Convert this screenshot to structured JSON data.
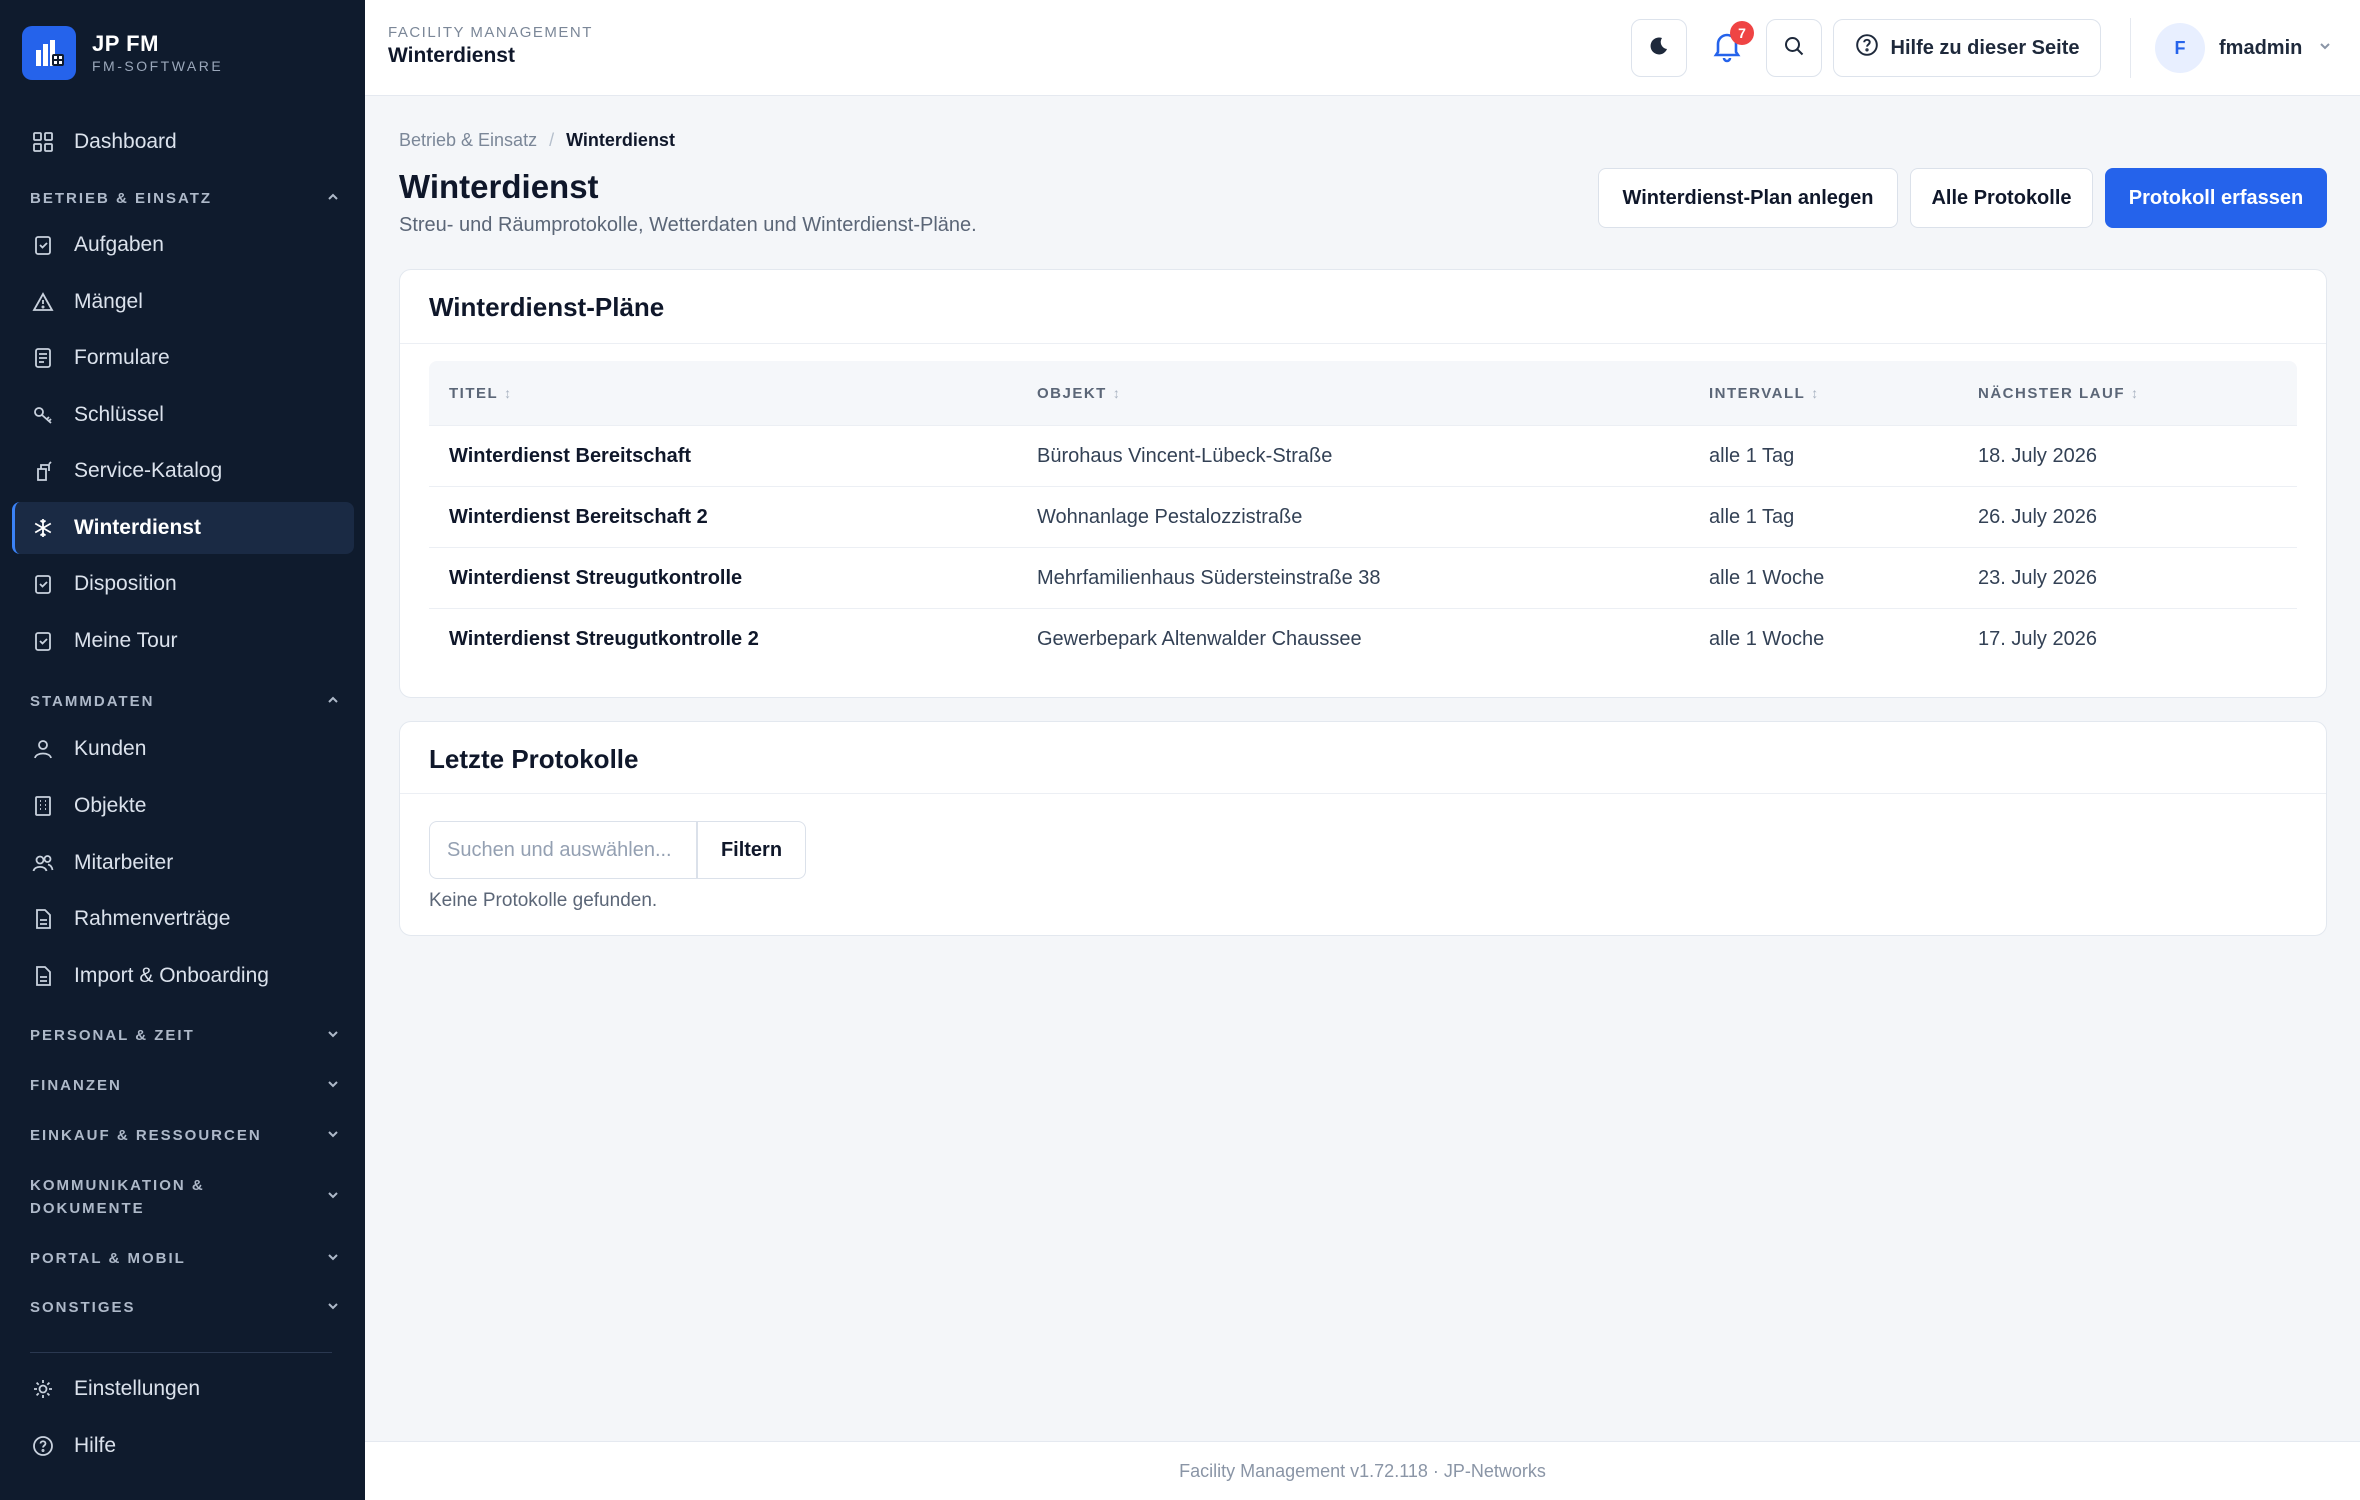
{
  "brand": {
    "title": "JP FM",
    "subtitle": "FM-SOFTWARE"
  },
  "sidebar": {
    "top_items": [
      {
        "label": "Dashboard",
        "icon": "grid-icon"
      }
    ],
    "sections": [
      {
        "label": "BETRIEB & EINSATZ",
        "expanded": true,
        "items": [
          {
            "label": "Aufgaben",
            "icon": "clipboard-check-icon"
          },
          {
            "label": "Mängel",
            "icon": "warning-triangle-icon"
          },
          {
            "label": "Formulare",
            "icon": "form-icon"
          },
          {
            "label": "Schlüssel",
            "icon": "key-icon"
          },
          {
            "label": "Service-Katalog",
            "icon": "service-icon"
          },
          {
            "label": "Winterdienst",
            "icon": "snowflake-icon",
            "active": true
          },
          {
            "label": "Disposition",
            "icon": "clipboard-check-icon"
          },
          {
            "label": "Meine Tour",
            "icon": "clipboard-check-icon"
          }
        ]
      },
      {
        "label": "STAMMDATEN",
        "expanded": true,
        "items": [
          {
            "label": "Kunden",
            "icon": "user-icon"
          },
          {
            "label": "Objekte",
            "icon": "building-icon"
          },
          {
            "label": "Mitarbeiter",
            "icon": "users-icon"
          },
          {
            "label": "Rahmenverträge",
            "icon": "document-icon"
          },
          {
            "label": "Import & Onboarding",
            "icon": "document-icon"
          }
        ]
      },
      {
        "label": "PERSONAL & ZEIT",
        "expanded": false
      },
      {
        "label": "FINANZEN",
        "expanded": false
      },
      {
        "label": "EINKAUF & RESSOURCEN",
        "expanded": false
      },
      {
        "label": "KOMMUNIKATION & DOKUMENTE",
        "expanded": false
      },
      {
        "label": "PORTAL & MOBIL",
        "expanded": false
      },
      {
        "label": "SONSTIGES",
        "expanded": false
      }
    ],
    "bottom_items": [
      {
        "label": "Einstellungen",
        "icon": "gear-icon"
      },
      {
        "label": "Hilfe",
        "icon": "help-circle-icon"
      }
    ]
  },
  "header": {
    "kicker": "FACILITY MANAGEMENT",
    "title": "Winterdienst",
    "notification_count": "7",
    "help_label": "Hilfe zu dieser Seite",
    "user_initial": "F",
    "user_name": "fmadmin"
  },
  "breadcrumb": {
    "parent": "Betrieb & Einsatz",
    "separator": "/",
    "current": "Winterdienst"
  },
  "page": {
    "title": "Winterdienst",
    "subtitle": "Streu- und Räumprotokolle, Wetterdaten und Winterdienst-Pläne.",
    "actions": {
      "create_plan": "Winterdienst-Plan anlegen",
      "all_protocols": "Alle Protokolle",
      "record_protocol": "Protokoll erfassen"
    }
  },
  "plans_card": {
    "title": "Winterdienst-Pläne",
    "columns": [
      "TITEL",
      "OBJEKT",
      "INTERVALL",
      "NÄCHSTER LAUF"
    ],
    "rows": [
      [
        "Winterdienst Bereitschaft",
        "Bürohaus Vincent-Lübeck-Straße",
        "alle 1 Tag",
        "18. July 2026"
      ],
      [
        "Winterdienst Bereitschaft 2",
        "Wohnanlage Pestalozzistraße",
        "alle 1 Tag",
        "26. July 2026"
      ],
      [
        "Winterdienst Streugutkontrolle",
        "Mehrfamilienhaus Südersteinstraße 38",
        "alle 1 Woche",
        "23. July 2026"
      ],
      [
        "Winterdienst Streugutkontrolle 2",
        "Gewerbepark Altenwalder Chaussee",
        "alle 1 Woche",
        "17. July 2026"
      ]
    ]
  },
  "protocols_card": {
    "title": "Letzte Protokolle",
    "search_placeholder": "Suchen und auswählen...",
    "search_value": "",
    "filter_label": "Filtern",
    "empty_message": "Keine Protokolle gefunden."
  },
  "footer": {
    "text": "Facility Management v1.72.118 · JP-Networks"
  },
  "colors": {
    "sidebar_bg": "#0f1b2d",
    "accent": "#2563eb",
    "badge": "#ef4444"
  }
}
